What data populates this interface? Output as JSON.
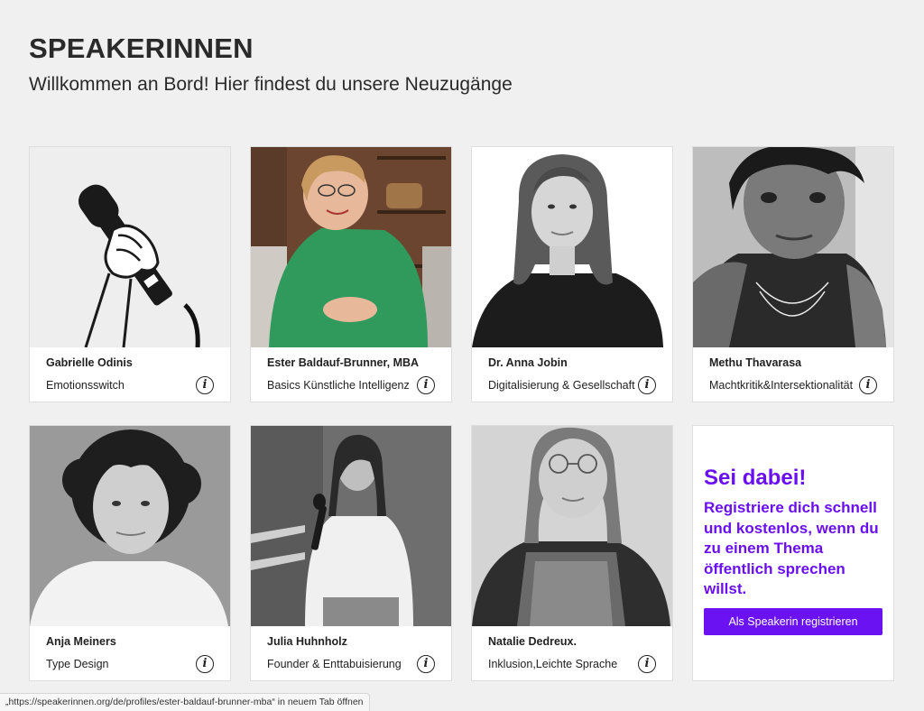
{
  "header": {
    "title": "SPEAKERINNEN",
    "subtitle": "Willkommen an Bord! Hier findest du unsere Neuzugänge"
  },
  "speakers": [
    {
      "name": "Gabrielle Odinis",
      "topic": "Emotionsswitch",
      "info_glyph": "i"
    },
    {
      "name": "Ester Baldauf-Brunner, MBA",
      "topic": "Basics Künstliche Intelligenz",
      "info_glyph": "i"
    },
    {
      "name": "Dr. Anna Jobin",
      "topic": "Digitalisierung & Gesellschaft",
      "info_glyph": "i"
    },
    {
      "name": "Methu Thavarasa",
      "topic": "Machtkritik&Intersektionalität",
      "info_glyph": "i"
    },
    {
      "name": "Anja Meiners",
      "topic": "Type Design",
      "info_glyph": "i"
    },
    {
      "name": "Julia Huhnholz",
      "topic": "Founder & Enttabuisierung",
      "info_glyph": "i"
    },
    {
      "name": "Natalie Dedreux.",
      "topic": "Inklusion,Leichte Sprache",
      "info_glyph": "i"
    }
  ],
  "cta": {
    "title": "Sei dabei!",
    "text": "Registriere dich schnell und kostenlos, wenn du zu einem Thema öffentlich sprechen willst.",
    "button_label": "Als Speakerin registrieren"
  },
  "status_bar": {
    "text": "„https://speakerinnen.org/de/profiles/ester-baldauf-brunner-mba“ in neuem Tab öffnen"
  },
  "colors": {
    "accent": "#6a12f2",
    "background": "#f0f0f0",
    "card": "#ffffff"
  },
  "icons": {
    "info": "info-circle-icon",
    "placeholder": "microphone-hand-icon"
  }
}
